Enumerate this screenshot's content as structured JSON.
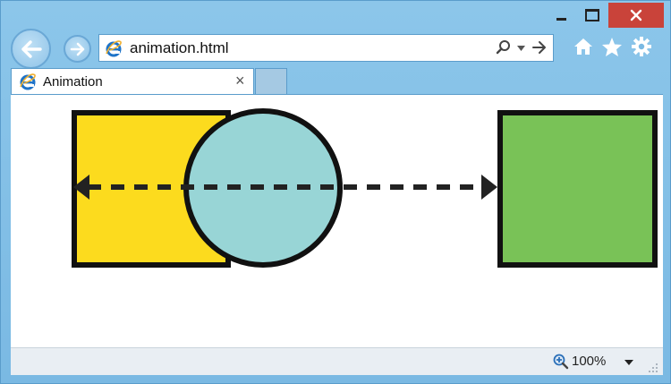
{
  "window": {
    "minimize_icon": "minimize-icon",
    "maximize_icon": "maximize-icon",
    "close_icon": "close-icon",
    "close_color": "#c9433a"
  },
  "nav": {
    "back_icon": "back-arrow-icon",
    "forward_icon": "forward-arrow-icon"
  },
  "address_bar": {
    "url": "animation.html",
    "search_icon": "search-icon",
    "dropdown_icon": "chevron-down-icon",
    "go_icon": "go-arrow-icon"
  },
  "toolbar": {
    "home_icon": "home-icon",
    "favorites_icon": "star-icon",
    "tools_icon": "gear-icon"
  },
  "tabs": [
    {
      "label": "Animation",
      "active": true,
      "close_icon": "close-icon"
    }
  ],
  "page": {
    "shapes": [
      {
        "name": "yellow-square",
        "color": "#fcdb1e"
      },
      {
        "name": "teal-circle",
        "color": "#98d5d6"
      },
      {
        "name": "green-square",
        "color": "#79c257"
      },
      {
        "name": "double-arrow",
        "color": "#222222"
      }
    ]
  },
  "statusbar": {
    "zoom": "100%",
    "zoom_icon": "zoom-icon",
    "zoom_dropdown_icon": "chevron-down-icon"
  }
}
